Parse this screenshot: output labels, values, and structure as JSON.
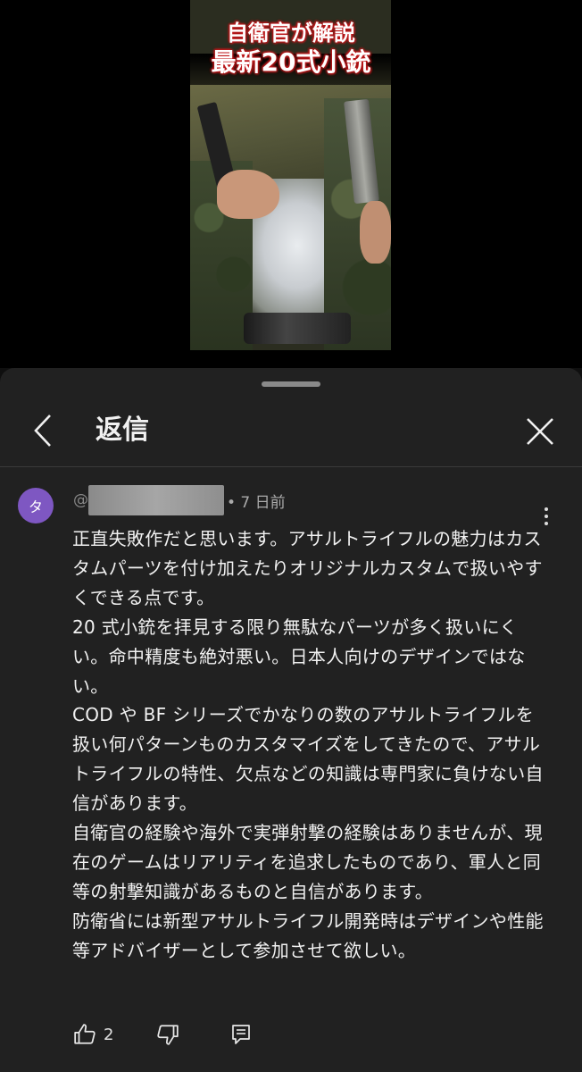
{
  "video": {
    "title_line1": "自衛官が解説",
    "title_line2": "最新20式小銃"
  },
  "sheet": {
    "header_title": "返信",
    "back_icon": "chevron-left-icon",
    "close_icon": "close-icon"
  },
  "comment": {
    "avatar_letter": "タ",
    "avatar_color": "#7e57c2",
    "author_prefix": "@",
    "timestamp": "• 7 日前",
    "paragraphs": [
      "正直失敗作だと思います。アサルトライフルの魅力はカスタムパーツを付け加えたりオリジナルカスタムで扱いやすくできる点です。",
      "20 式小銃を拝見する限り無駄なパーツが多く扱いにくい。命中精度も絶対悪い。日本人向けのデザインではない。",
      "COD や BF シリーズでかなりの数のアサルトライフルを扱い何パターンものカスタマイズをしてきたので、アサルトライフルの特性、欠点などの知識は専門家に負けない自信があります。",
      "自衛官の経験や海外で実弾射撃の経験はありませんが、現在のゲームはリアリティを追求したものであり、軍人と同等の射撃知識があるものと自信があります。",
      "防衛省には新型アサルトライフル開発時はデザインや性能等アドバイザーとして参加させて欲しい。"
    ],
    "like_count": "2"
  }
}
